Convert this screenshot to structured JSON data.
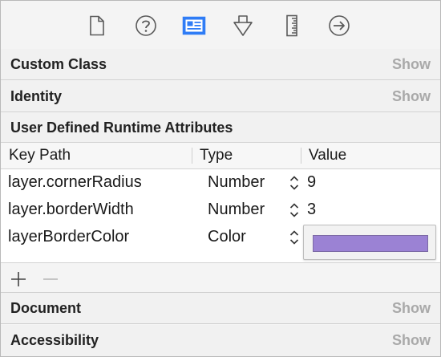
{
  "toolbar": {
    "tabs": [
      {
        "name": "file-inspector-icon",
        "selected": false
      },
      {
        "name": "help-inspector-icon",
        "selected": false
      },
      {
        "name": "identity-inspector-icon",
        "selected": true
      },
      {
        "name": "attributes-inspector-icon",
        "selected": false
      },
      {
        "name": "size-inspector-icon",
        "selected": false
      },
      {
        "name": "connections-inspector-icon",
        "selected": false
      }
    ],
    "accent_color": "#2f7cf6"
  },
  "sections": {
    "custom_class": {
      "title": "Custom Class",
      "action": "Show"
    },
    "identity": {
      "title": "Identity",
      "action": "Show"
    },
    "runtime_attributes": {
      "title": "User Defined Runtime Attributes"
    },
    "document": {
      "title": "Document",
      "action": "Show"
    },
    "accessibility": {
      "title": "Accessibility",
      "action": "Show"
    }
  },
  "attributes_table": {
    "columns": [
      "Key Path",
      "Type",
      "Value"
    ],
    "rows": [
      {
        "key_path": "layer.cornerRadius",
        "type": "Number",
        "value": "9"
      },
      {
        "key_path": "layer.borderWidth",
        "type": "Number",
        "value": "3"
      },
      {
        "key_path": "layerBorderColor",
        "type": "Color",
        "value_color": "#9b82d4"
      }
    ]
  },
  "controls": {
    "add_icon": "plus-icon",
    "remove_icon": "minus-icon"
  }
}
